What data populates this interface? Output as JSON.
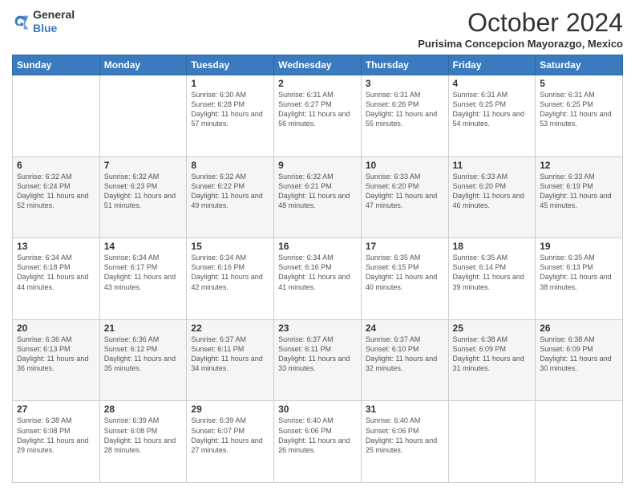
{
  "header": {
    "logo": {
      "general": "General",
      "blue": "Blue"
    },
    "title": "October 2024",
    "location": "Purisima Concepcion Mayorazgo, Mexico"
  },
  "weekdays": [
    "Sunday",
    "Monday",
    "Tuesday",
    "Wednesday",
    "Thursday",
    "Friday",
    "Saturday"
  ],
  "weeks": [
    [
      {
        "day": "",
        "sunrise": "",
        "sunset": "",
        "daylight": ""
      },
      {
        "day": "",
        "sunrise": "",
        "sunset": "",
        "daylight": ""
      },
      {
        "day": "1",
        "sunrise": "Sunrise: 6:30 AM",
        "sunset": "Sunset: 6:28 PM",
        "daylight": "Daylight: 11 hours and 57 minutes."
      },
      {
        "day": "2",
        "sunrise": "Sunrise: 6:31 AM",
        "sunset": "Sunset: 6:27 PM",
        "daylight": "Daylight: 11 hours and 56 minutes."
      },
      {
        "day": "3",
        "sunrise": "Sunrise: 6:31 AM",
        "sunset": "Sunset: 6:26 PM",
        "daylight": "Daylight: 11 hours and 55 minutes."
      },
      {
        "day": "4",
        "sunrise": "Sunrise: 6:31 AM",
        "sunset": "Sunset: 6:25 PM",
        "daylight": "Daylight: 11 hours and 54 minutes."
      },
      {
        "day": "5",
        "sunrise": "Sunrise: 6:31 AM",
        "sunset": "Sunset: 6:25 PM",
        "daylight": "Daylight: 11 hours and 53 minutes."
      }
    ],
    [
      {
        "day": "6",
        "sunrise": "Sunrise: 6:32 AM",
        "sunset": "Sunset: 6:24 PM",
        "daylight": "Daylight: 11 hours and 52 minutes."
      },
      {
        "day": "7",
        "sunrise": "Sunrise: 6:32 AM",
        "sunset": "Sunset: 6:23 PM",
        "daylight": "Daylight: 11 hours and 51 minutes."
      },
      {
        "day": "8",
        "sunrise": "Sunrise: 6:32 AM",
        "sunset": "Sunset: 6:22 PM",
        "daylight": "Daylight: 11 hours and 49 minutes."
      },
      {
        "day": "9",
        "sunrise": "Sunrise: 6:32 AM",
        "sunset": "Sunset: 6:21 PM",
        "daylight": "Daylight: 11 hours and 48 minutes."
      },
      {
        "day": "10",
        "sunrise": "Sunrise: 6:33 AM",
        "sunset": "Sunset: 6:20 PM",
        "daylight": "Daylight: 11 hours and 47 minutes."
      },
      {
        "day": "11",
        "sunrise": "Sunrise: 6:33 AM",
        "sunset": "Sunset: 6:20 PM",
        "daylight": "Daylight: 11 hours and 46 minutes."
      },
      {
        "day": "12",
        "sunrise": "Sunrise: 6:33 AM",
        "sunset": "Sunset: 6:19 PM",
        "daylight": "Daylight: 11 hours and 45 minutes."
      }
    ],
    [
      {
        "day": "13",
        "sunrise": "Sunrise: 6:34 AM",
        "sunset": "Sunset: 6:18 PM",
        "daylight": "Daylight: 11 hours and 44 minutes."
      },
      {
        "day": "14",
        "sunrise": "Sunrise: 6:34 AM",
        "sunset": "Sunset: 6:17 PM",
        "daylight": "Daylight: 11 hours and 43 minutes."
      },
      {
        "day": "15",
        "sunrise": "Sunrise: 6:34 AM",
        "sunset": "Sunset: 6:16 PM",
        "daylight": "Daylight: 11 hours and 42 minutes."
      },
      {
        "day": "16",
        "sunrise": "Sunrise: 6:34 AM",
        "sunset": "Sunset: 6:16 PM",
        "daylight": "Daylight: 11 hours and 41 minutes."
      },
      {
        "day": "17",
        "sunrise": "Sunrise: 6:35 AM",
        "sunset": "Sunset: 6:15 PM",
        "daylight": "Daylight: 11 hours and 40 minutes."
      },
      {
        "day": "18",
        "sunrise": "Sunrise: 6:35 AM",
        "sunset": "Sunset: 6:14 PM",
        "daylight": "Daylight: 11 hours and 39 minutes."
      },
      {
        "day": "19",
        "sunrise": "Sunrise: 6:35 AM",
        "sunset": "Sunset: 6:13 PM",
        "daylight": "Daylight: 11 hours and 38 minutes."
      }
    ],
    [
      {
        "day": "20",
        "sunrise": "Sunrise: 6:36 AM",
        "sunset": "Sunset: 6:13 PM",
        "daylight": "Daylight: 11 hours and 36 minutes."
      },
      {
        "day": "21",
        "sunrise": "Sunrise: 6:36 AM",
        "sunset": "Sunset: 6:12 PM",
        "daylight": "Daylight: 11 hours and 35 minutes."
      },
      {
        "day": "22",
        "sunrise": "Sunrise: 6:37 AM",
        "sunset": "Sunset: 6:11 PM",
        "daylight": "Daylight: 11 hours and 34 minutes."
      },
      {
        "day": "23",
        "sunrise": "Sunrise: 6:37 AM",
        "sunset": "Sunset: 6:11 PM",
        "daylight": "Daylight: 11 hours and 33 minutes."
      },
      {
        "day": "24",
        "sunrise": "Sunrise: 6:37 AM",
        "sunset": "Sunset: 6:10 PM",
        "daylight": "Daylight: 11 hours and 32 minutes."
      },
      {
        "day": "25",
        "sunrise": "Sunrise: 6:38 AM",
        "sunset": "Sunset: 6:09 PM",
        "daylight": "Daylight: 11 hours and 31 minutes."
      },
      {
        "day": "26",
        "sunrise": "Sunrise: 6:38 AM",
        "sunset": "Sunset: 6:09 PM",
        "daylight": "Daylight: 11 hours and 30 minutes."
      }
    ],
    [
      {
        "day": "27",
        "sunrise": "Sunrise: 6:38 AM",
        "sunset": "Sunset: 6:08 PM",
        "daylight": "Daylight: 11 hours and 29 minutes."
      },
      {
        "day": "28",
        "sunrise": "Sunrise: 6:39 AM",
        "sunset": "Sunset: 6:08 PM",
        "daylight": "Daylight: 11 hours and 28 minutes."
      },
      {
        "day": "29",
        "sunrise": "Sunrise: 6:39 AM",
        "sunset": "Sunset: 6:07 PM",
        "daylight": "Daylight: 11 hours and 27 minutes."
      },
      {
        "day": "30",
        "sunrise": "Sunrise: 6:40 AM",
        "sunset": "Sunset: 6:06 PM",
        "daylight": "Daylight: 11 hours and 26 minutes."
      },
      {
        "day": "31",
        "sunrise": "Sunrise: 6:40 AM",
        "sunset": "Sunset: 6:06 PM",
        "daylight": "Daylight: 11 hours and 25 minutes."
      },
      {
        "day": "",
        "sunrise": "",
        "sunset": "",
        "daylight": ""
      },
      {
        "day": "",
        "sunrise": "",
        "sunset": "",
        "daylight": ""
      }
    ]
  ]
}
